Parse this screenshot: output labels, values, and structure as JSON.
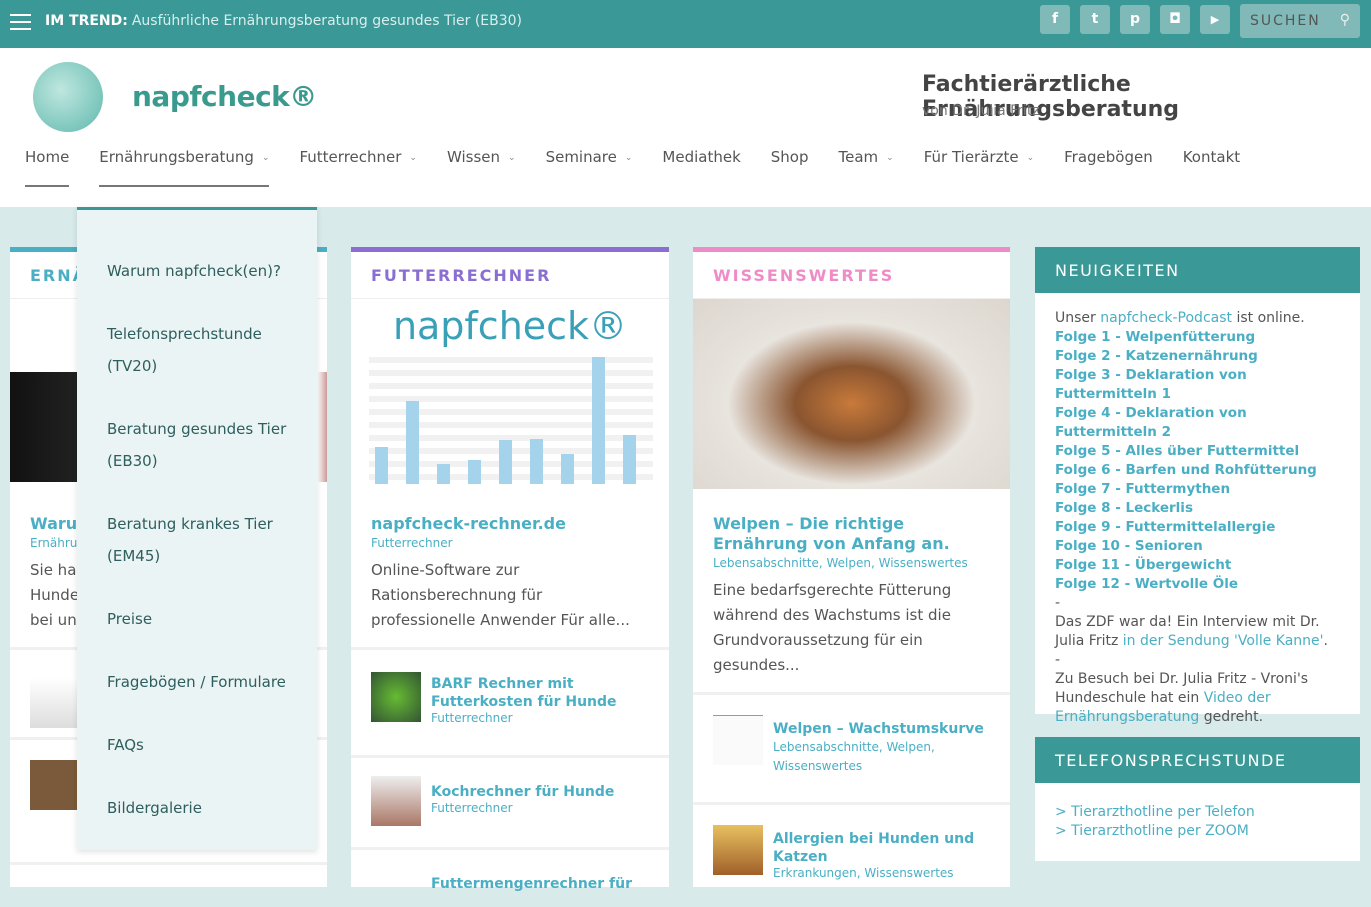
{
  "topbar": {
    "trend_label": "IM TREND:",
    "trend_text": "Ausführliche Ernährungsberatung gesundes Tier (EB30)",
    "social": [
      "facebook-icon",
      "twitter-icon",
      "pinterest-icon",
      "instagram-icon",
      "youtube-icon"
    ],
    "social_glyphs": [
      "f",
      "t",
      "p",
      "◘",
      "▶"
    ],
    "search_placeholder": "SUCHEN"
  },
  "header": {
    "logo": "napfcheck®",
    "tagline": "Fachtierärztliche Ernährungsberatung",
    "byline": "von Dr. Julia Fritz"
  },
  "nav": [
    {
      "label": "Home"
    },
    {
      "label": "Ernährungsberatung",
      "dropdown": true
    },
    {
      "label": "Futterrechner",
      "dropdown": true
    },
    {
      "label": "Wissen",
      "dropdown": true
    },
    {
      "label": "Seminare",
      "dropdown": true
    },
    {
      "label": "Mediathek"
    },
    {
      "label": "Shop"
    },
    {
      "label": "Team",
      "dropdown": true
    },
    {
      "label": "Für Tierärzte",
      "dropdown": true
    },
    {
      "label": "Fragebögen"
    },
    {
      "label": "Kontakt"
    }
  ],
  "dropdown": [
    "Warum napfcheck(en)?",
    "Telefonsprechstunde (TV20)",
    "Beratung gesundes Tier (EB30)",
    "Beratung krankes Tier (EM45)",
    "Preise",
    "Fragebögen / Formulare",
    "FAQs",
    "Bildergalerie"
  ],
  "col1": {
    "heading": "ERNÄ",
    "title": "Warum",
    "meta": "Ernährung",
    "excerpt": [
      "Sie hab",
      "Hunde",
      "bei uns"
    ]
  },
  "col2": {
    "heading": "FUTTERRECHNER",
    "image_logo": "napfcheck®",
    "title": "napfcheck-rechner.de",
    "meta": "Futterrechner",
    "excerpt": "Online-Software zur Rationsberechnung für professionelle Anwender Für alle...",
    "items": [
      {
        "title": "BARF Rechner mit Futterkosten für Hunde",
        "meta": "Futterrechner"
      },
      {
        "title": "Kochrechner für Hunde",
        "meta": "Futterrechner"
      },
      {
        "title": "Futtermengenrechner für"
      }
    ]
  },
  "col3": {
    "heading": "WISSENSWERTES",
    "title": "Welpen – Die richtige Ernährung von Anfang an.",
    "meta": "Lebensabschnitte, Welpen, Wissenswertes",
    "excerpt": "Eine bedarfsgerechte Fütterung während des Wachstums ist die Grundvoraussetzung für ein gesundes...",
    "items": [
      {
        "title": "Welpen – Wachstumskurve",
        "meta": "Lebensabschnitte, Welpen, Wissenswertes"
      },
      {
        "title": "Allergien bei Hunden und Katzen",
        "meta": "Erkrankungen, Wissenswertes"
      }
    ]
  },
  "news": {
    "heading": "NEUIGKEITEN",
    "intro_pre": "Unser ",
    "intro_link": "napfcheck-Podcast",
    "intro_post": " ist online.",
    "episodes": [
      "Folge 1 - Welpenfütterung",
      "Folge 2 - Katzenernährung",
      "Folge 3 - Deklaration von Futtermitteln 1",
      "Folge 4 - Deklaration von Futtermitteln 2",
      "Folge 5 - Alles über Futtermittel",
      "Folge 6 - Barfen und Rohfütterung",
      "Folge 7 - Futtermythen",
      "Folge 8 - Leckerlis",
      "Folge 9 - Futtermittelallergie",
      "Folge 10 - Senioren",
      "Folge 11 - Übergewicht",
      "Folge 12 - Wertvolle Öle"
    ],
    "dash": "-",
    "zdf_pre": "Das ZDF war da! Ein Interview mit Dr. Julia Fritz ",
    "zdf_link": "in der Sendung 'Volle Kanne'",
    "zdf_post": ".",
    "vroni_pre": "Zu Besuch bei Dr. Julia Fritz - Vroni's Hundeschule hat ein ",
    "vroni_link": "Video der Ernährungsberatung",
    "vroni_post": " gedreht."
  },
  "phone": {
    "heading": "TELEFONSPRECHSTUNDE",
    "links": [
      "> Tierarzthotline per Telefon",
      "> Tierarzthotline per ZOOM"
    ]
  },
  "colors": {
    "teal": "#3a9896",
    "link": "#4aafc4",
    "purple": "#8a6fd1",
    "pink": "#ee8cc8"
  }
}
